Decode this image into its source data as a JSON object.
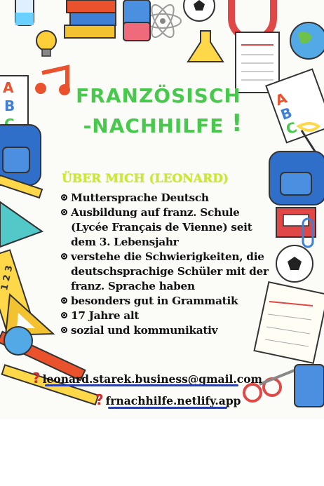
{
  "poster": {
    "title_line1": "FRANZÖSISCH",
    "title_line2": "-NACHHILFE",
    "title_exclamation": "!",
    "title_color": "#49c84e"
  },
  "about": {
    "heading": "ÜBER MICH (LEONARD)",
    "heading_color": "#cde830",
    "items": [
      "Muttersprache Deutsch",
      "Ausbildung auf franz. Schule (Lycée Français de Vienne) seit dem 3. Lebensjahr",
      "verstehe die Schwierigkeiten, die deutschsprachige Schüler mit der franz. Sprache haben",
      "besonders gut in Grammatik",
      "17 Jahre alt",
      "sozial und kommunikativ"
    ]
  },
  "contact": {
    "marker_icon": "question-mark-icon",
    "marker": "?",
    "email": "leonard.starek.business@gmail.com",
    "website": "frnachhilfe.netlify.app",
    "underline_color": "#2b3fa8"
  }
}
